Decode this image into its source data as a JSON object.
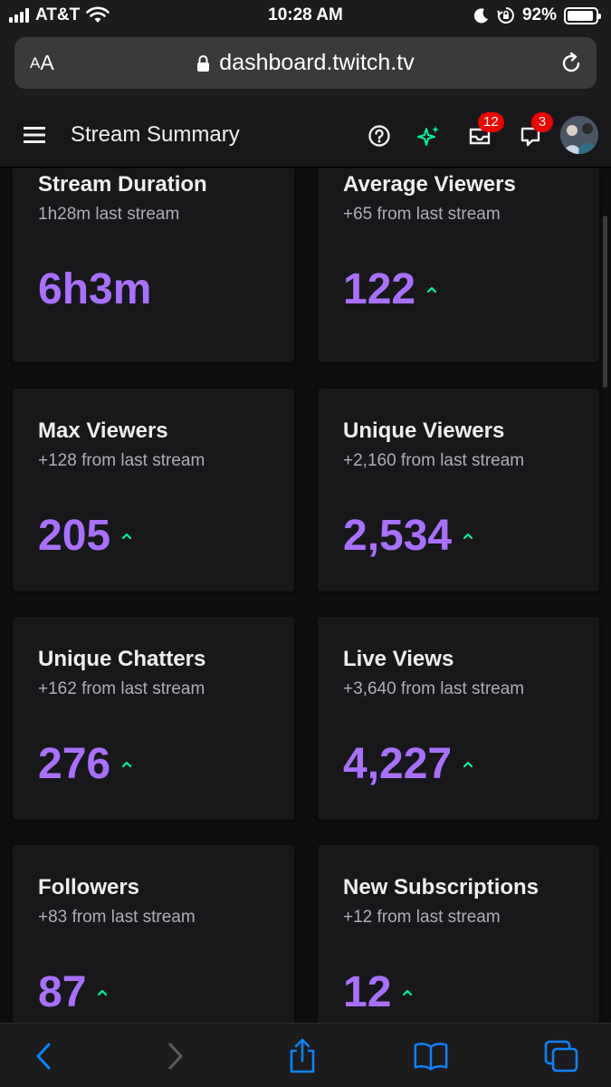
{
  "status_bar": {
    "carrier": "AT&T",
    "time": "10:28 AM",
    "battery_percent": "92%",
    "battery_level": 0.92
  },
  "browser": {
    "text_size_label_small": "A",
    "text_size_label_big": "A",
    "url": "dashboard.twitch.tv"
  },
  "header": {
    "title": "Stream Summary",
    "inbox_badge": "12",
    "whispers_badge": "3"
  },
  "stats": [
    {
      "title": "Stream Duration",
      "subtitle": "1h28m last stream",
      "value": "6h3m",
      "trend": "none"
    },
    {
      "title": "Average Viewers",
      "subtitle": "+65 from last stream",
      "value": "122",
      "trend": "up"
    },
    {
      "title": "Max Viewers",
      "subtitle": "+128 from last stream",
      "value": "205",
      "trend": "up"
    },
    {
      "title": "Unique Viewers",
      "subtitle": "+2,160 from last stream",
      "value": "2,534",
      "trend": "up"
    },
    {
      "title": "Unique Chatters",
      "subtitle": "+162 from last stream",
      "value": "276",
      "trend": "up"
    },
    {
      "title": "Live Views",
      "subtitle": "+3,640 from last stream",
      "value": "4,227",
      "trend": "up"
    },
    {
      "title": "Followers",
      "subtitle": "+83 from last stream",
      "value": "87",
      "trend": "up"
    },
    {
      "title": "New Subscriptions",
      "subtitle": "+12 from last stream",
      "value": "12",
      "trend": "up"
    }
  ],
  "colors": {
    "accent": "#a970ff",
    "trend_up": "#00f593",
    "badge": "#eb0400"
  }
}
